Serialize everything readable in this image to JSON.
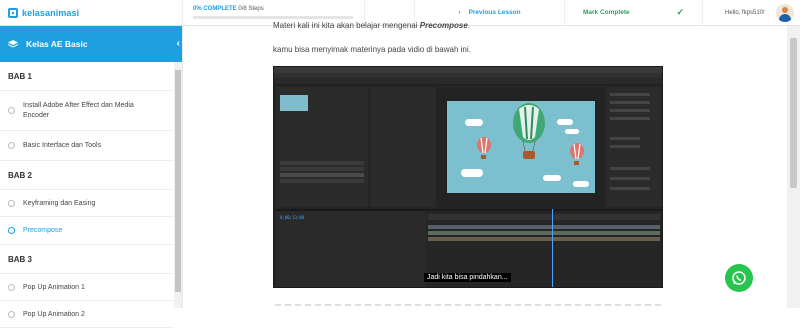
{
  "topbar": {
    "logo_text": "kelasanimasi",
    "progress_percent_label": "0% COMPLETE",
    "progress_steps": "0/8 Steps",
    "progress_value": 0,
    "previous_lesson": "Previous Lesson",
    "mark_complete": "Mark Complete",
    "greeting": "Hello, fkps510!"
  },
  "sidebar": {
    "course_title": "Kelas AE Basic",
    "sections": [
      {
        "title": "BAB 1",
        "items": [
          {
            "label": "Install Adobe After Effect dan Media Encoder"
          },
          {
            "label": "Basic Interface dan Tools"
          }
        ]
      },
      {
        "title": "BAB 2",
        "items": [
          {
            "label": "Keyframing dan Easing"
          },
          {
            "label": "Precompose"
          }
        ]
      },
      {
        "title": "BAB 3",
        "items": [
          {
            "label": "Pop Up Animation 1"
          },
          {
            "label": "Pop Up Animation 2"
          }
        ]
      }
    ]
  },
  "main": {
    "para1_before": "Materi kali ini kita akan belajar mengenai ",
    "para1_emph": "Precompose",
    "para1_after": ".",
    "para2": "kamu bisa menyimak materinya pada vidio di bawah ini.",
    "video_caption": "Jadi kita bisa pindahkan...",
    "video_time": "0;00;13;00"
  },
  "colors": {
    "accent": "#1d9fe2",
    "complete": "#2e9d5b",
    "whatsapp": "#27c44e"
  }
}
